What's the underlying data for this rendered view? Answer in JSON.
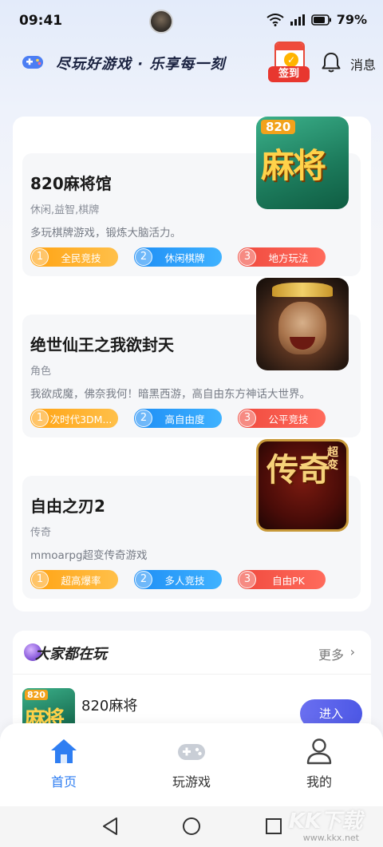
{
  "status_bar": {
    "time": "09:41",
    "battery": "79%"
  },
  "header": {
    "slogan": "尽玩好游戏 · 乐享每一刻",
    "checkin_label": "签到",
    "message_label": "消息"
  },
  "games": [
    {
      "title": "820麻将馆",
      "category": "休闲,益智,棋牌",
      "description": "多玩棋牌游戏，锻炼大脑活力。",
      "icon": {
        "badge": "820",
        "text": "麻将"
      },
      "tags": [
        {
          "num": "1",
          "text": "全民竞技"
        },
        {
          "num": "2",
          "text": "休闲棋牌"
        },
        {
          "num": "3",
          "text": "地方玩法"
        }
      ]
    },
    {
      "title": "绝世仙王之我欲封天",
      "category": "角色",
      "description": "我欲成魔，佛奈我何！暗黑西游，高自由东方神话大世界。",
      "icon": {},
      "tags": [
        {
          "num": "1",
          "text": "次时代3DM..."
        },
        {
          "num": "2",
          "text": "高自由度"
        },
        {
          "num": "3",
          "text": "公平竞技"
        }
      ]
    },
    {
      "title": "自由之刃2",
      "category": "传奇",
      "description": "mmoarpg超变传奇游戏",
      "icon": {
        "text": "传奇",
        "small": "超变"
      },
      "tags": [
        {
          "num": "1",
          "text": "超高爆率"
        },
        {
          "num": "2",
          "text": "多人竞技"
        },
        {
          "num": "3",
          "text": "自由PK"
        }
      ]
    }
  ],
  "popular": {
    "title": "大家都在玩",
    "more_label": "更多",
    "items": [
      {
        "name": "820麻将",
        "thumb_badge": "820",
        "thumb_text": "麻将",
        "button_label": "进入"
      }
    ]
  },
  "tab_bar": {
    "tabs": [
      {
        "label": "首页"
      },
      {
        "label": "玩游戏"
      },
      {
        "label": "我的"
      }
    ],
    "active_color": "#2f7ef2"
  },
  "watermark": {
    "text": "KK下载",
    "sub": "www.kkx.net"
  }
}
